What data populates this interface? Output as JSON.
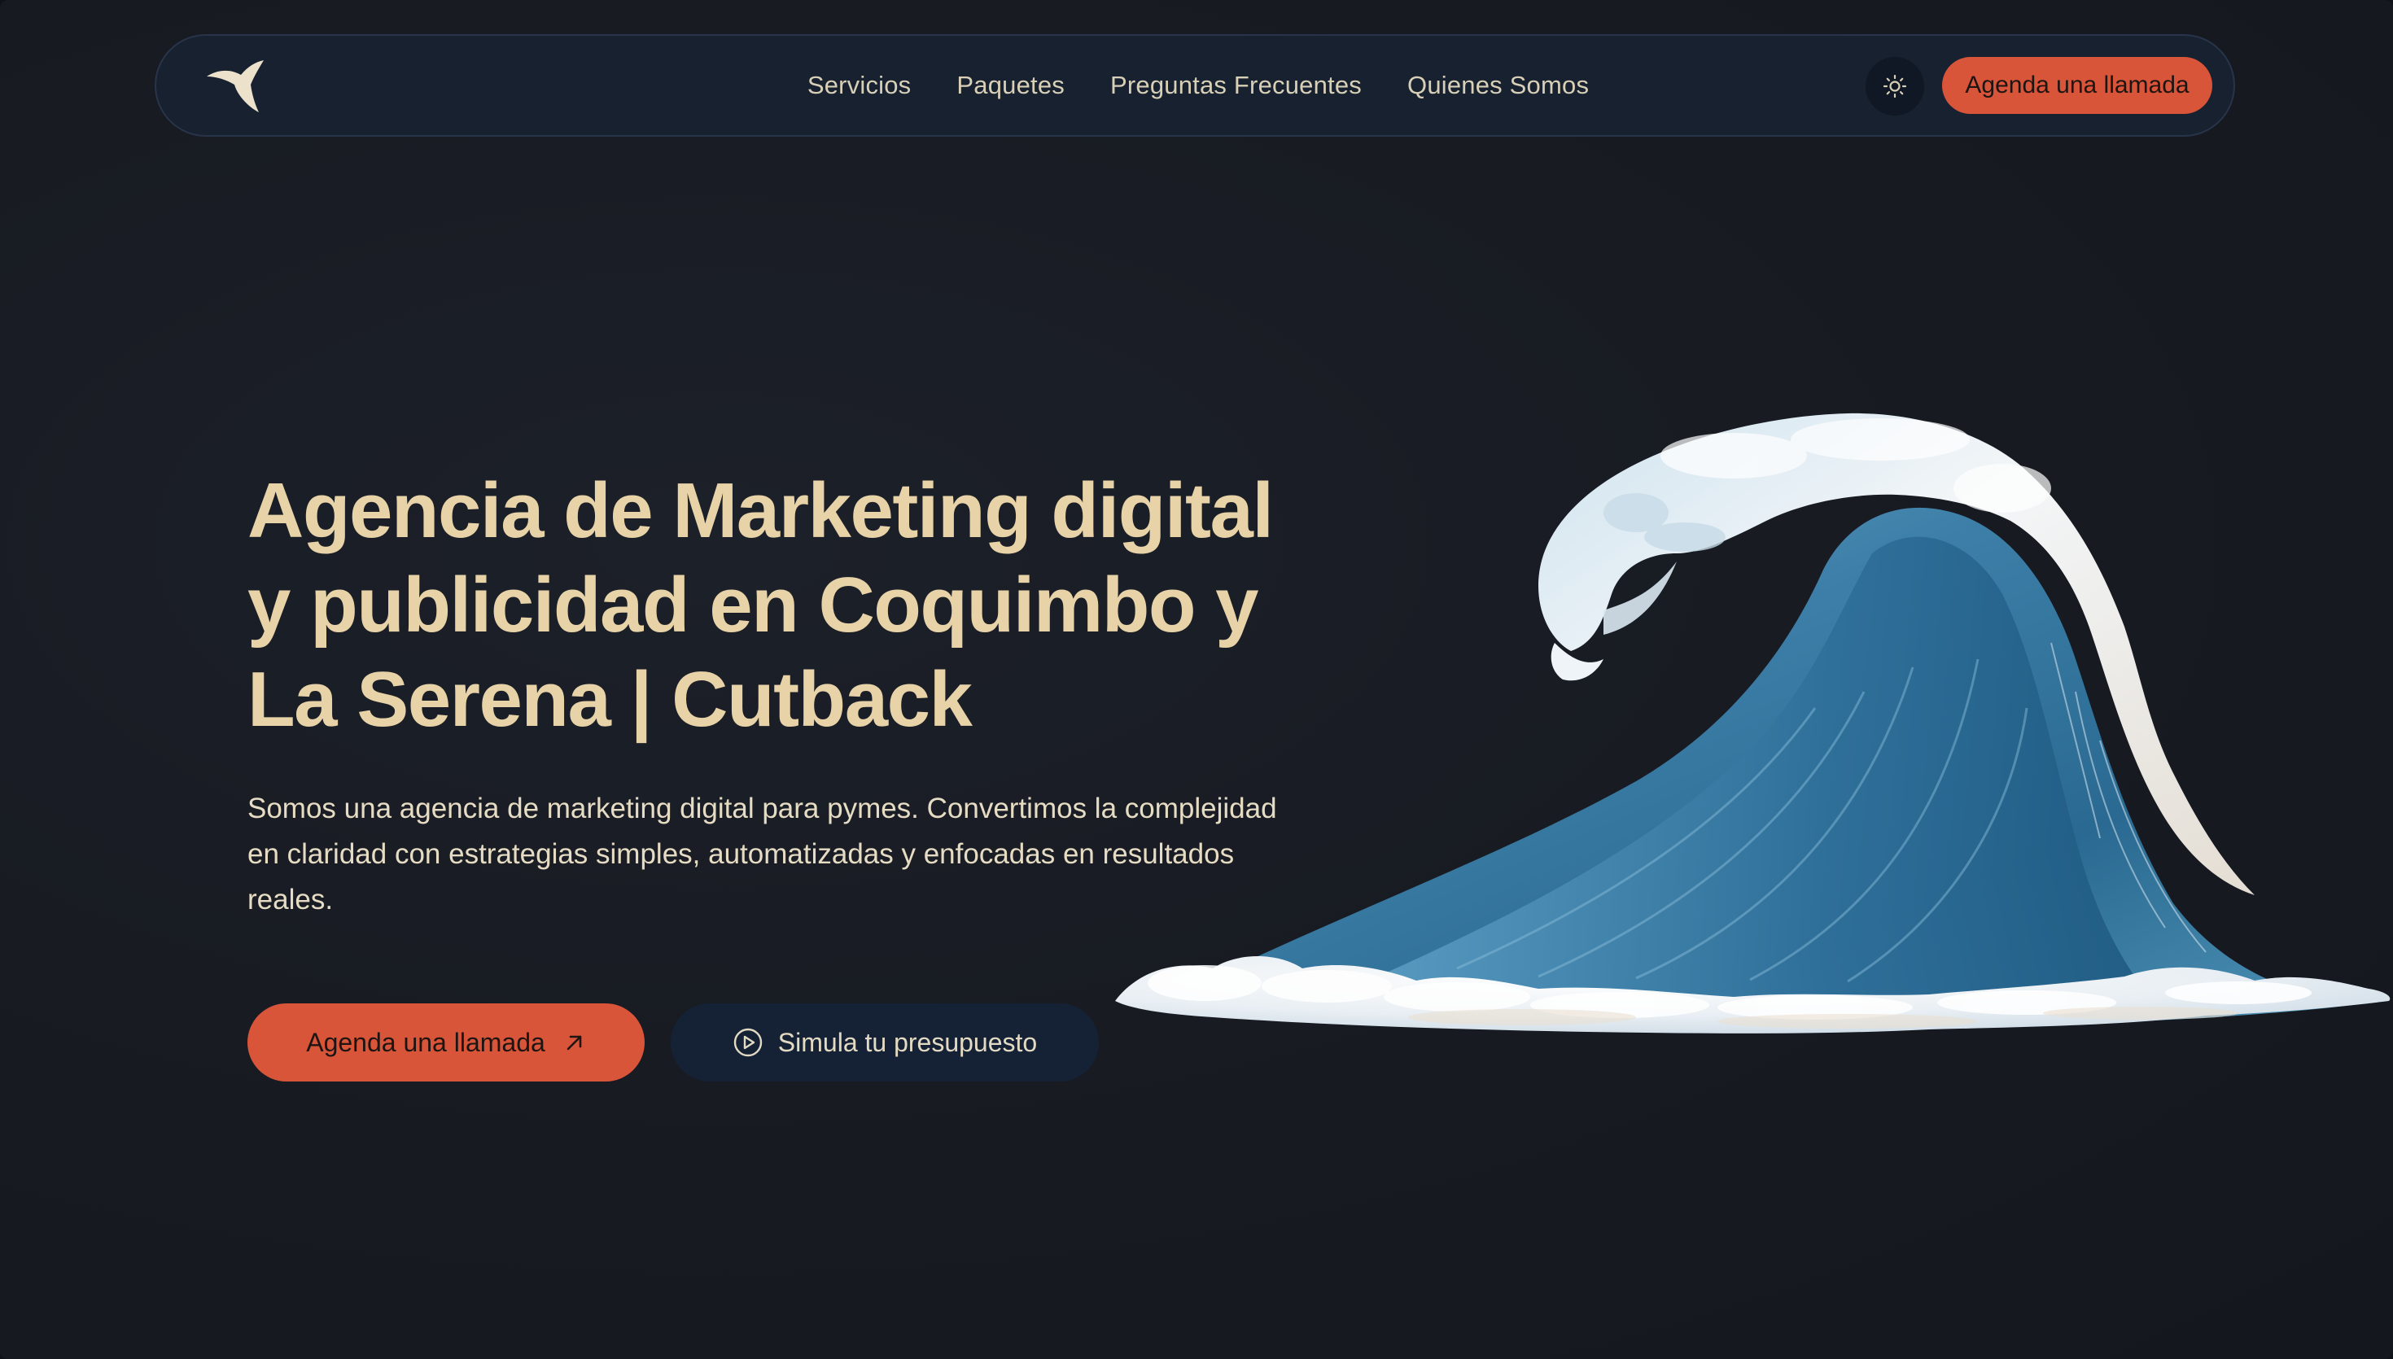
{
  "nav": {
    "logo_icon": "cutback-logo-icon",
    "links": [
      {
        "label": "Servicios"
      },
      {
        "label": "Paquetes"
      },
      {
        "label": "Preguntas Frecuentes"
      },
      {
        "label": "Quienes Somos"
      }
    ],
    "theme_toggle_icon": "sun-icon",
    "cta_label": "Agenda una llamada"
  },
  "hero": {
    "title_line1": "Agencia de Marketing digital",
    "title_line2": "y publicidad en Coquimbo y",
    "title_line3": "La Serena | Cutback",
    "subtitle_line1": "Somos una agencia de marketing digital para pymes. Convertimos la complejidad",
    "subtitle_line2": "en claridad con estrategias simples, automatizadas y enfocadas en resultados",
    "subtitle_line3": "reales.",
    "primary_button": {
      "label": "Agenda una llamada",
      "icon": "arrow-up-right-icon"
    },
    "secondary_button": {
      "label": "Simula tu presupuesto",
      "icon": "play-circle-icon"
    },
    "illustration": "ocean-wave-image"
  },
  "colors": {
    "background": "#181b22",
    "accent": "#d9553a",
    "title": "#e8d3a8",
    "text": "#e6dcc4",
    "nav_bg": "#172130"
  }
}
